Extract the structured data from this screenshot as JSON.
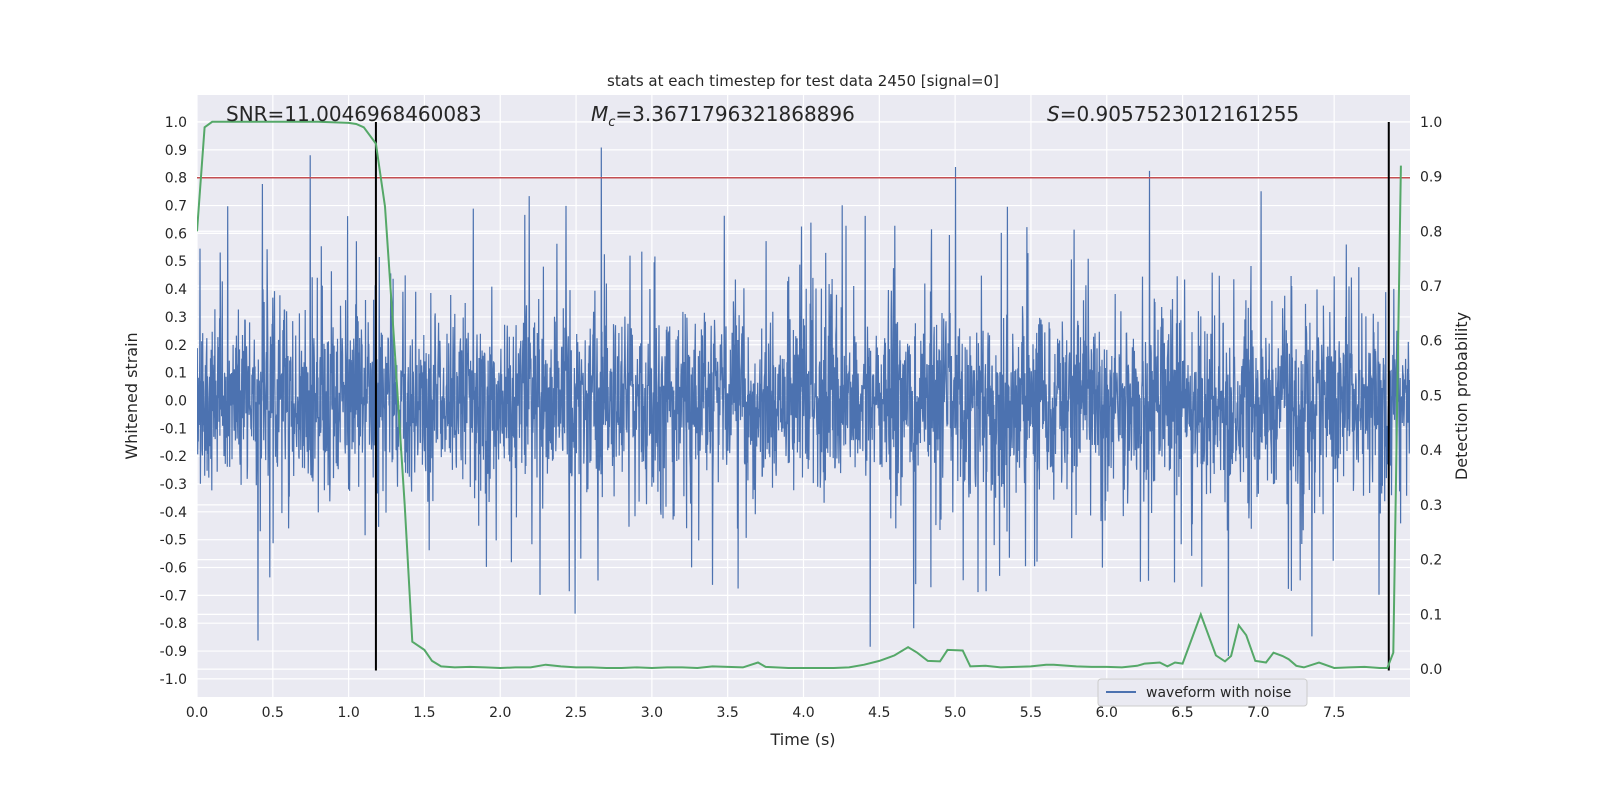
{
  "chart_data": {
    "type": "line",
    "title": "stats at each timestep for test data 2450 [signal=0]",
    "xlabel": "Time (s)",
    "ylabel": "Whitened strain",
    "ylabel_right": "Detection probability",
    "xlim": [
      0,
      8.0
    ],
    "ylim": [
      -1.065,
      1.097
    ],
    "ylim_right": [
      -0.051,
      1.049
    ],
    "grid": true,
    "legend_position": "bottom-right",
    "xticks": [
      "0.0",
      "0.5",
      "1.0",
      "1.5",
      "2.0",
      "2.5",
      "3.0",
      "3.5",
      "4.0",
      "4.5",
      "5.0",
      "5.5",
      "6.0",
      "6.5",
      "7.0",
      "7.5"
    ],
    "yticks": [
      "1.0",
      "0.9",
      "0.8",
      "0.7",
      "0.6",
      "0.5",
      "0.4",
      "0.3",
      "0.2",
      "0.1",
      "0.0",
      "-0.1",
      "-0.2",
      "-0.3",
      "-0.4",
      "-0.5",
      "-0.6",
      "-0.7",
      "-0.8",
      "-0.9",
      "-1.0"
    ],
    "yticks_right": [
      "1.0",
      "0.9",
      "0.8",
      "0.7",
      "0.6",
      "0.5",
      "0.4",
      "0.3",
      "0.2",
      "0.1",
      "0.0"
    ],
    "annotations": {
      "snr": "SNR=11.0046968460083",
      "mc_symbol": "M",
      "mc_sub": "c",
      "mc_value": "=3.3671796321868896",
      "s_symbol": "S",
      "s_value": "=0.9057523012161255"
    },
    "threshold_line": {
      "y": 0.8,
      "color": "#c44e52"
    },
    "vertical_lines": [
      1.18,
      7.86
    ],
    "waveform": {
      "name": "waveform with noise",
      "color": "#4c72b0"
    },
    "detection_probability": {
      "color": "#55a868",
      "x": [
        0.0,
        0.05,
        0.1,
        0.2,
        0.4,
        0.6,
        0.8,
        1.0,
        1.05,
        1.1,
        1.18,
        1.24,
        1.3,
        1.37,
        1.42,
        1.5,
        1.55,
        1.61,
        1.7,
        1.8,
        1.9,
        2.0,
        2.1,
        2.2,
        2.3,
        2.4,
        2.5,
        2.6,
        2.7,
        2.8,
        2.9,
        3.0,
        3.1,
        3.2,
        3.3,
        3.4,
        3.5,
        3.6,
        3.7,
        3.75,
        3.9,
        4.0,
        4.2,
        4.3,
        4.4,
        4.5,
        4.6,
        4.69,
        4.75,
        4.82,
        4.9,
        4.95,
        5.05,
        5.1,
        5.2,
        5.3,
        5.4,
        5.5,
        5.6,
        5.65,
        5.8,
        5.9,
        6.0,
        6.1,
        6.2,
        6.25,
        6.35,
        6.4,
        6.45,
        6.5,
        6.62,
        6.72,
        6.78,
        6.82,
        6.87,
        6.92,
        6.98,
        7.05,
        7.1,
        7.16,
        7.2,
        7.25,
        7.3,
        7.4,
        7.5,
        7.6,
        7.7,
        7.8,
        7.85,
        7.89,
        7.94
      ],
      "y": [
        0.8,
        0.99,
        1.0,
        1.0,
        1.0,
        1.0,
        1.0,
        0.998,
        0.996,
        0.99,
        0.96,
        0.845,
        0.6,
        0.3,
        0.05,
        0.035,
        0.015,
        0.005,
        0.003,
        0.004,
        0.003,
        0.002,
        0.003,
        0.003,
        0.008,
        0.005,
        0.003,
        0.003,
        0.002,
        0.002,
        0.003,
        0.002,
        0.003,
        0.003,
        0.002,
        0.005,
        0.004,
        0.003,
        0.012,
        0.004,
        0.002,
        0.002,
        0.002,
        0.003,
        0.008,
        0.015,
        0.025,
        0.04,
        0.03,
        0.015,
        0.014,
        0.035,
        0.034,
        0.005,
        0.006,
        0.003,
        0.004,
        0.005,
        0.008,
        0.008,
        0.005,
        0.004,
        0.004,
        0.003,
        0.006,
        0.01,
        0.012,
        0.005,
        0.012,
        0.01,
        0.1,
        0.025,
        0.014,
        0.024,
        0.08,
        0.062,
        0.015,
        0.012,
        0.03,
        0.024,
        0.018,
        0.006,
        0.003,
        0.012,
        0.002,
        0.003,
        0.004,
        0.002,
        0.002,
        0.03,
        0.92
      ]
    }
  }
}
